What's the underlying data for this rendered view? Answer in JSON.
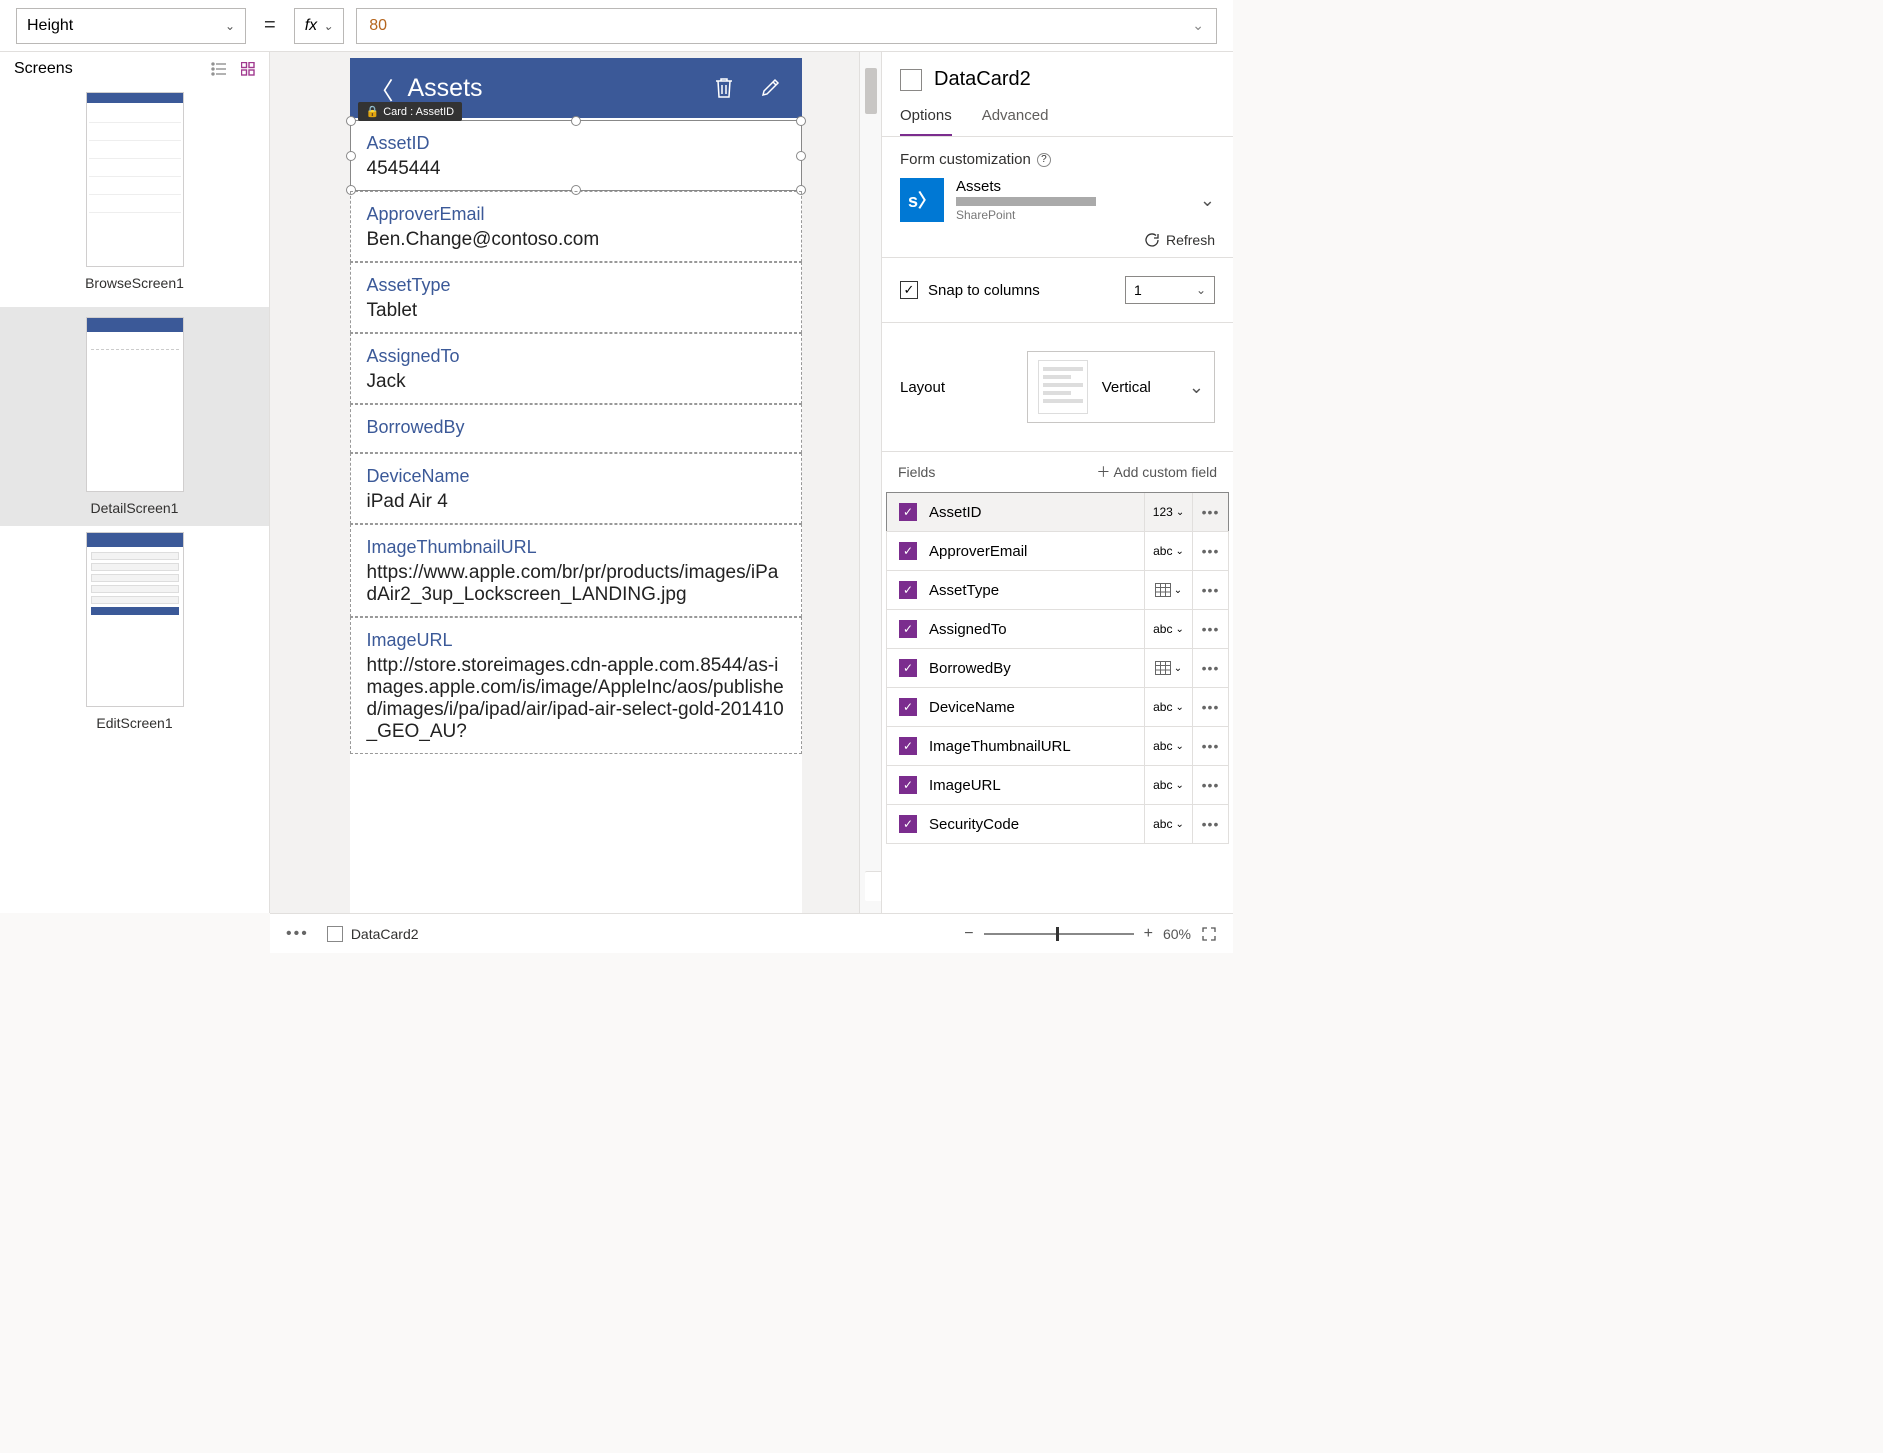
{
  "formula": {
    "property": "Height",
    "value": "80",
    "fx": "fx"
  },
  "left_panel": {
    "title": "Screens",
    "screens": [
      "BrowseScreen1",
      "DetailScreen1",
      "EditScreen1"
    ],
    "selected": 1
  },
  "canvas": {
    "appbar_title": "Assets",
    "lock_tag": "Card : AssetID",
    "cards": [
      {
        "label": "AssetID",
        "value": "4545444"
      },
      {
        "label": "ApproverEmail",
        "value": "Ben.Change@contoso.com"
      },
      {
        "label": "AssetType",
        "value": "Tablet"
      },
      {
        "label": "AssignedTo",
        "value": "Jack"
      },
      {
        "label": "BorrowedBy",
        "value": ""
      },
      {
        "label": "DeviceName",
        "value": "iPad Air 4"
      },
      {
        "label": "ImageThumbnailURL",
        "value": "https://www.apple.com/br/pr/products/images/iPadAir2_3up_Lockscreen_LANDING.jpg"
      },
      {
        "label": "ImageURL",
        "value": "http://store.storeimages.cdn-apple.com.8544/as-images.apple.com/is/image/AppleInc/aos/published/images/i/pa/ipad/air/ipad-air-select-gold-201410_GEO_AU?"
      }
    ]
  },
  "right": {
    "selected_name": "DataCard2",
    "tabs": [
      "Options",
      "Advanced"
    ],
    "form_cust": "Form customization",
    "datasource": {
      "name": "Assets",
      "provider": "SharePoint"
    },
    "refresh": "Refresh",
    "snap": "Snap to columns",
    "columns": "1",
    "layout_label": "Layout",
    "layout_value": "Vertical",
    "fields_label": "Fields",
    "add_field": "Add custom field",
    "fields": [
      {
        "name": "AssetID",
        "type": "123",
        "selected": true
      },
      {
        "name": "ApproverEmail",
        "type": "abc"
      },
      {
        "name": "AssetType",
        "type": "grid"
      },
      {
        "name": "AssignedTo",
        "type": "abc"
      },
      {
        "name": "BorrowedBy",
        "type": "grid"
      },
      {
        "name": "DeviceName",
        "type": "abc"
      },
      {
        "name": "ImageThumbnailURL",
        "type": "abc"
      },
      {
        "name": "ImageURL",
        "type": "abc"
      },
      {
        "name": "SecurityCode",
        "type": "abc"
      }
    ]
  },
  "bottom": {
    "breadcrumb": "DataCard2",
    "zoom": "60%"
  }
}
